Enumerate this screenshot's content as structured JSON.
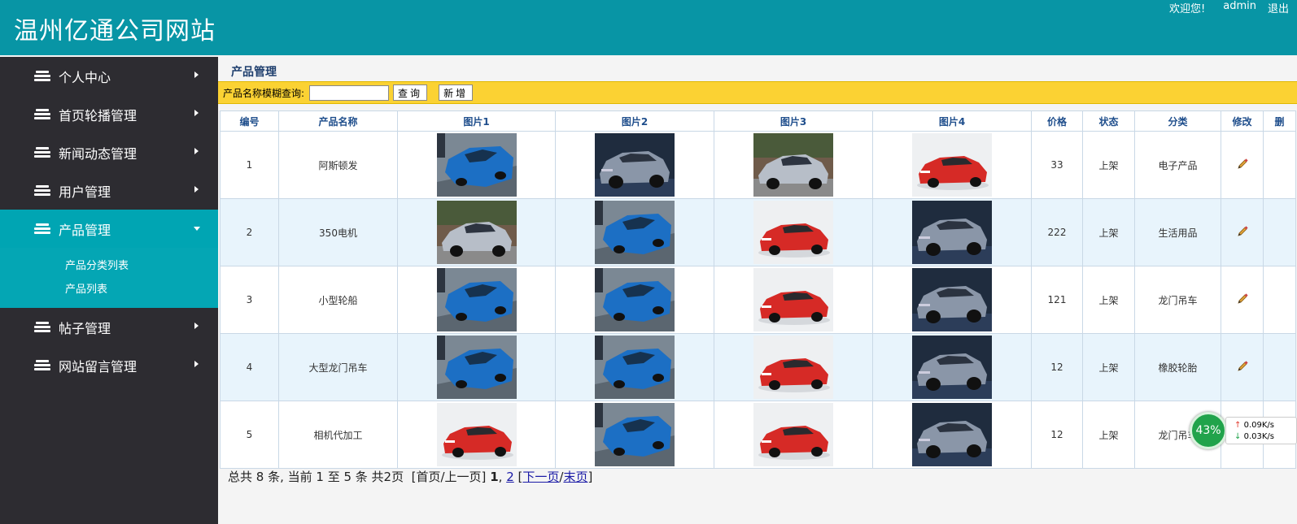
{
  "header": {
    "site_title": "温州亿通公司网站",
    "welcome": "欢迎您!",
    "username": "admin",
    "logout": "退出"
  },
  "sidebar": {
    "items": [
      {
        "label": "个人中心"
      },
      {
        "label": "首页轮播管理"
      },
      {
        "label": "新闻动态管理"
      },
      {
        "label": "用户管理"
      },
      {
        "label": "产品管理",
        "active": true
      },
      {
        "label": "帖子管理"
      },
      {
        "label": "网站留言管理"
      }
    ],
    "subitems": [
      {
        "label": "产品分类列表"
      },
      {
        "label": "产品列表"
      }
    ]
  },
  "main": {
    "heading": "产品管理",
    "search": {
      "label": "产品名称模糊查询:",
      "value": "",
      "query_button": "查询",
      "add_button": "新增"
    },
    "table": {
      "columns": [
        "编号",
        "产品名称",
        "图片1",
        "图片2",
        "图片3",
        "图片4",
        "价格",
        "状态",
        "分类",
        "修改",
        "删"
      ],
      "rows": [
        {
          "id": "1",
          "name": "阿斯顿发",
          "images": [
            "blue-sedan",
            "grey-suv",
            "silver-sedan",
            "red-sedan"
          ],
          "price": "33",
          "status": "上架",
          "category": "电子产品"
        },
        {
          "id": "2",
          "name": "350电机",
          "images": [
            "silver-sedan",
            "blue-sedan",
            "red-sedan",
            "grey-suv"
          ],
          "price": "222",
          "status": "上架",
          "category": "生活用品"
        },
        {
          "id": "3",
          "name": "小型轮船",
          "images": [
            "blue-sedan",
            "blue-sedan",
            "red-sedan",
            "grey-suv"
          ],
          "price": "121",
          "status": "上架",
          "category": "龙门吊车"
        },
        {
          "id": "4",
          "name": "大型龙门吊车",
          "images": [
            "blue-sedan",
            "blue-sedan",
            "red-sedan",
            "grey-suv"
          ],
          "price": "12",
          "status": "上架",
          "category": "橡胶轮胎"
        },
        {
          "id": "5",
          "name": "相机代加工",
          "images": [
            "red-sedan",
            "blue-sedan",
            "red-sedan",
            "grey-suv"
          ],
          "price": "12",
          "status": "上架",
          "category": "龙门吊车"
        }
      ]
    },
    "pager": {
      "summary": "总共 8 条, 当前 1 至 5 条 共2页",
      "first_prev": "[首页/上一页]",
      "current": "1",
      "sep": ",",
      "page2": "2",
      "next": "下一页",
      "last": "末页"
    }
  },
  "net_widget": {
    "percent": "43%",
    "up": "0.09K/s",
    "down": "0.03K/s"
  },
  "colors": {
    "header_bg": "#0895a5",
    "sidebar_bg": "#2d2c31",
    "sidebar_active": "#00a5b3",
    "search_bar": "#fbd233"
  }
}
